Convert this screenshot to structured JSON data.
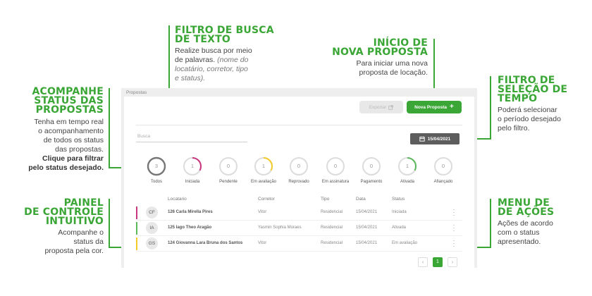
{
  "annotations": {
    "filtro_busca": {
      "title": [
        "FILTRO DE BUSCA",
        "DE TEXTO"
      ],
      "text": [
        "Realize busca por meio",
        "de palavras."
      ],
      "italic": [
        "(nome do",
        "locatário, corretor, tipo",
        "e status)."
      ]
    },
    "nova_proposta": {
      "title": [
        "INÍCIO DE",
        "NOVA PROPOSTA"
      ],
      "text": [
        "Para iniciar uma nova",
        "proposta de locação."
      ]
    },
    "filtro_tempo": {
      "title": [
        "FILTRO DE",
        "SELEÇÃO DE",
        "TEMPO"
      ],
      "text": [
        "Poderá selecionar",
        "o período desejado",
        "pelo filtro."
      ]
    },
    "acompanhe": {
      "title": [
        "ACOMPANHE",
        "STATUS DAS",
        "PROPOSTAS"
      ],
      "text": [
        "Tenha em tempo real",
        "o acompanhamento",
        "de todos os status",
        "das propostas."
      ],
      "bold": [
        "Clique para filtrar",
        "pelo status desejado."
      ]
    },
    "painel": {
      "title": [
        "PAINEL",
        "DE CONTROLE",
        "INTUITIVO"
      ],
      "text": [
        "Acompanhe o",
        "status da",
        "proposta pela cor."
      ]
    },
    "menu": {
      "title": [
        "MENU DE",
        "DE AÇÕES"
      ],
      "text": [
        "Ações de acordo",
        "com o status",
        "apresentado."
      ]
    }
  },
  "app": {
    "title": "Propostas",
    "export_label": "Exportar",
    "new_label": "Nova Proposta",
    "search_placeholder": "Busca",
    "date": "15/04/2021",
    "statuses": [
      {
        "label": "Todos",
        "count": "3",
        "color": "#777777",
        "progress": 1.0
      },
      {
        "label": "Iniciada",
        "count": "1",
        "color": "#c8367d",
        "progress": 0.33
      },
      {
        "label": "Pendente",
        "count": "0",
        "color": "#cccccc",
        "progress": 0
      },
      {
        "label": "Em avaliação",
        "count": "1",
        "color": "#f2cb2a",
        "progress": 0.33
      },
      {
        "label": "Reprovado",
        "count": "0",
        "color": "#cccccc",
        "progress": 0
      },
      {
        "label": "Em assinatura",
        "count": "0",
        "color": "#cccccc",
        "progress": 0
      },
      {
        "label": "Pagamento",
        "count": "0",
        "color": "#cccccc",
        "progress": 0
      },
      {
        "label": "Ativada",
        "count": "1",
        "color": "#5cb85c",
        "progress": 0.33
      },
      {
        "label": "Afiançado",
        "count": "0",
        "color": "#cccccc",
        "progress": 0
      }
    ],
    "columns": [
      "Locatario",
      "Corretor",
      "Tipo",
      "Data",
      "Status"
    ],
    "rows": [
      {
        "initials": "CF",
        "name": "126 Carla Mirella Pires",
        "corretor": "Vitor",
        "tipo": "Residencial",
        "data": "15/04/2021",
        "status": "Iniciada",
        "color": "#c8367d"
      },
      {
        "initials": "IA",
        "name": "125 Iago Theo Aragão",
        "corretor": "Yasmin Sophia Moraes",
        "tipo": "Residencial",
        "data": "15/04/2021",
        "status": "Ativada",
        "color": "#5cb85c"
      },
      {
        "initials": "GS",
        "name": "124 Giovanna Lara Bruna dos Santos",
        "corretor": "Vitor",
        "tipo": "Residencial",
        "data": "15/04/2021",
        "status": "Em avaliação",
        "color": "#f2cb2a"
      }
    ],
    "pagination": {
      "prev": "‹",
      "current": "1",
      "next": "›"
    }
  }
}
